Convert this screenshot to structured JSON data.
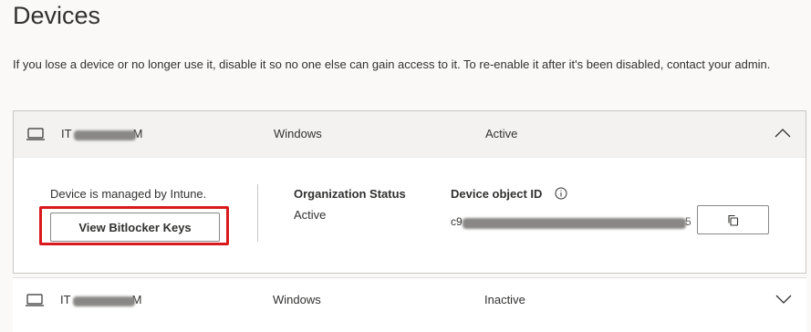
{
  "page": {
    "title": "Devices"
  },
  "intro": "If you lose a device or no longer use it, disable it so no one else can gain access to it. To re-enable it after it's been disabled, contact your admin.",
  "devices": [
    {
      "name_prefix": "IT",
      "name_suffix": "M",
      "os": "Windows",
      "status": "Active",
      "expanded": true,
      "details": {
        "managed_text": "Device is managed by Intune.",
        "bitlocker_button": "View Bitlocker Keys",
        "org_status_label": "Organization Status",
        "org_status_value": "Active",
        "device_id_label": "Device object ID",
        "device_id_prefix": "c9",
        "device_id_suffix": "5"
      }
    },
    {
      "name_prefix": "IT",
      "name_suffix": "M",
      "os": "Windows",
      "status": "Inactive",
      "expanded": false
    }
  ],
  "colors": {
    "highlight": "#d9191c",
    "expanded_header": "#f3f2f1",
    "page_background": "#faf9f8"
  },
  "icons": {
    "device": "laptop-icon",
    "collapse": "chevron-up-icon",
    "expand": "chevron-down-icon",
    "info": "info-icon",
    "copy": "copy-icon"
  }
}
